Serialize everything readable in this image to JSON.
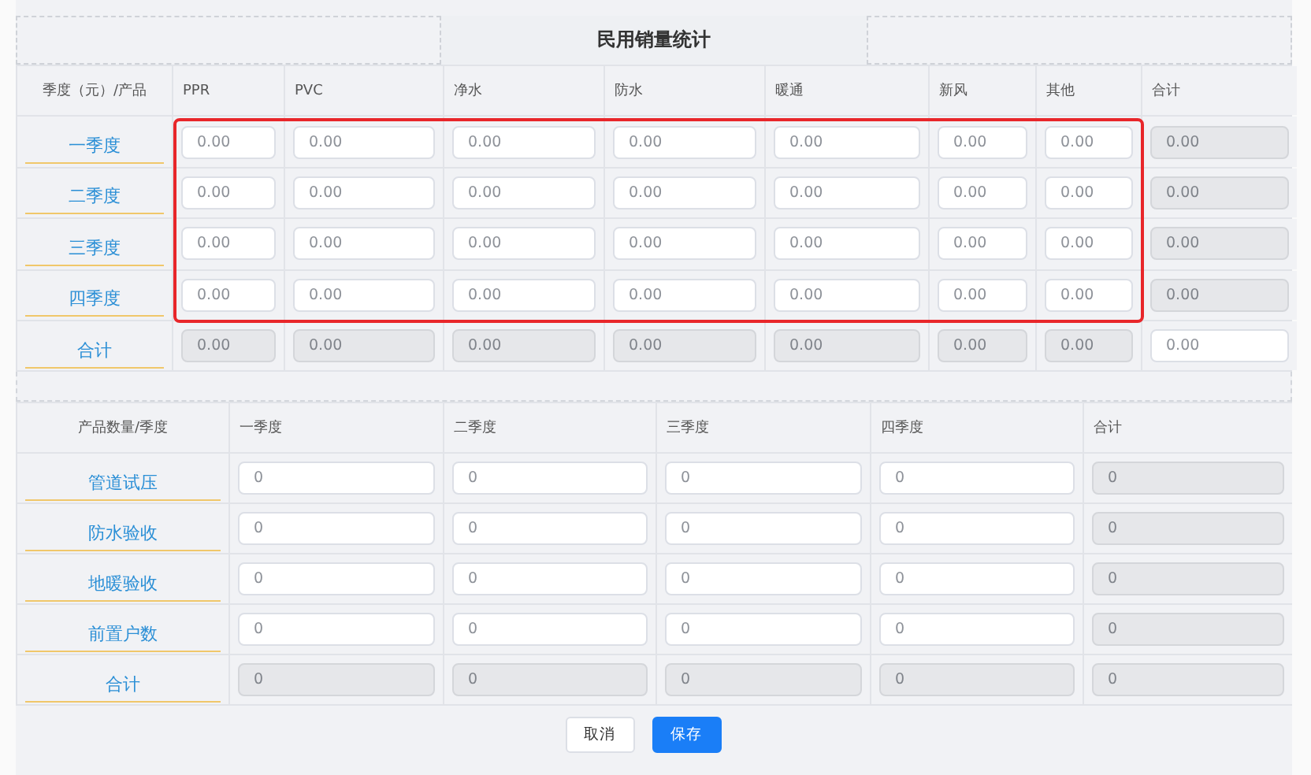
{
  "title": "民用销量统计",
  "sales_table": {
    "corner": "季度（元）/产品",
    "columns": [
      {
        "label": "PPR"
      },
      {
        "label": "PVC"
      },
      {
        "label": "净水"
      },
      {
        "label": "防水"
      },
      {
        "label": "暖通"
      },
      {
        "label": "新风"
      },
      {
        "label": "其他"
      },
      {
        "label": "合计"
      }
    ],
    "highlight_frame": {
      "color": "#e8262a"
    },
    "rows": [
      {
        "label": "一季度",
        "cells": [
          {
            "placeholder": "0.00",
            "disabled": false
          },
          {
            "placeholder": "0.00",
            "disabled": false
          },
          {
            "placeholder": "0.00",
            "disabled": false
          },
          {
            "placeholder": "0.00",
            "disabled": false
          },
          {
            "placeholder": "0.00",
            "disabled": false
          },
          {
            "placeholder": "0.00",
            "disabled": false
          },
          {
            "placeholder": "0.00",
            "disabled": false
          },
          {
            "placeholder": "0.00",
            "disabled": true
          }
        ]
      },
      {
        "label": "二季度",
        "cells": [
          {
            "placeholder": "0.00",
            "disabled": false
          },
          {
            "placeholder": "0.00",
            "disabled": false
          },
          {
            "placeholder": "0.00",
            "disabled": false
          },
          {
            "placeholder": "0.00",
            "disabled": false
          },
          {
            "placeholder": "0.00",
            "disabled": false
          },
          {
            "placeholder": "0.00",
            "disabled": false
          },
          {
            "placeholder": "0.00",
            "disabled": false
          },
          {
            "placeholder": "0.00",
            "disabled": true
          }
        ]
      },
      {
        "label": "三季度",
        "cells": [
          {
            "placeholder": "0.00",
            "disabled": false
          },
          {
            "placeholder": "0.00",
            "disabled": false
          },
          {
            "placeholder": "0.00",
            "disabled": false
          },
          {
            "placeholder": "0.00",
            "disabled": false
          },
          {
            "placeholder": "0.00",
            "disabled": false
          },
          {
            "placeholder": "0.00",
            "disabled": false
          },
          {
            "placeholder": "0.00",
            "disabled": false
          },
          {
            "placeholder": "0.00",
            "disabled": true
          }
        ]
      },
      {
        "label": "四季度",
        "cells": [
          {
            "placeholder": "0.00",
            "disabled": false
          },
          {
            "placeholder": "0.00",
            "disabled": false
          },
          {
            "placeholder": "0.00",
            "disabled": false
          },
          {
            "placeholder": "0.00",
            "disabled": false
          },
          {
            "placeholder": "0.00",
            "disabled": false
          },
          {
            "placeholder": "0.00",
            "disabled": false
          },
          {
            "placeholder": "0.00",
            "disabled": false
          },
          {
            "placeholder": "0.00",
            "disabled": true
          }
        ]
      },
      {
        "label": "合计",
        "cells": [
          {
            "placeholder": "0.00",
            "disabled": true
          },
          {
            "placeholder": "0.00",
            "disabled": true
          },
          {
            "placeholder": "0.00",
            "disabled": true
          },
          {
            "placeholder": "0.00",
            "disabled": true
          },
          {
            "placeholder": "0.00",
            "disabled": true
          },
          {
            "placeholder": "0.00",
            "disabled": true
          },
          {
            "placeholder": "0.00",
            "disabled": true
          },
          {
            "placeholder": "0.00",
            "disabled": false
          }
        ]
      }
    ]
  },
  "count_table": {
    "corner": "产品数量/季度",
    "columns": [
      {
        "label": "一季度"
      },
      {
        "label": "二季度"
      },
      {
        "label": "三季度"
      },
      {
        "label": "四季度"
      },
      {
        "label": "合计"
      }
    ],
    "rows": [
      {
        "label": "管道试压",
        "cells": [
          {
            "placeholder": "0",
            "disabled": false
          },
          {
            "placeholder": "0",
            "disabled": false
          },
          {
            "placeholder": "0",
            "disabled": false
          },
          {
            "placeholder": "0",
            "disabled": false
          },
          {
            "placeholder": "0",
            "disabled": true
          }
        ]
      },
      {
        "label": "防水验收",
        "cells": [
          {
            "placeholder": "0",
            "disabled": false
          },
          {
            "placeholder": "0",
            "disabled": false
          },
          {
            "placeholder": "0",
            "disabled": false
          },
          {
            "placeholder": "0",
            "disabled": false
          },
          {
            "placeholder": "0",
            "disabled": true
          }
        ]
      },
      {
        "label": "地暖验收",
        "cells": [
          {
            "placeholder": "0",
            "disabled": false
          },
          {
            "placeholder": "0",
            "disabled": false
          },
          {
            "placeholder": "0",
            "disabled": false
          },
          {
            "placeholder": "0",
            "disabled": false
          },
          {
            "placeholder": "0",
            "disabled": true
          }
        ]
      },
      {
        "label": "前置户数",
        "cells": [
          {
            "placeholder": "0",
            "disabled": false
          },
          {
            "placeholder": "0",
            "disabled": false
          },
          {
            "placeholder": "0",
            "disabled": false
          },
          {
            "placeholder": "0",
            "disabled": false
          },
          {
            "placeholder": "0",
            "disabled": true
          }
        ]
      },
      {
        "label": "合计",
        "cells": [
          {
            "placeholder": "0",
            "disabled": true
          },
          {
            "placeholder": "0",
            "disabled": true
          },
          {
            "placeholder": "0",
            "disabled": true
          },
          {
            "placeholder": "0",
            "disabled": true
          },
          {
            "placeholder": "0",
            "disabled": true
          }
        ]
      }
    ]
  },
  "buttons": [
    {
      "label": "取消",
      "kind": "secondary"
    },
    {
      "label": "保存",
      "kind": "primary"
    }
  ]
}
